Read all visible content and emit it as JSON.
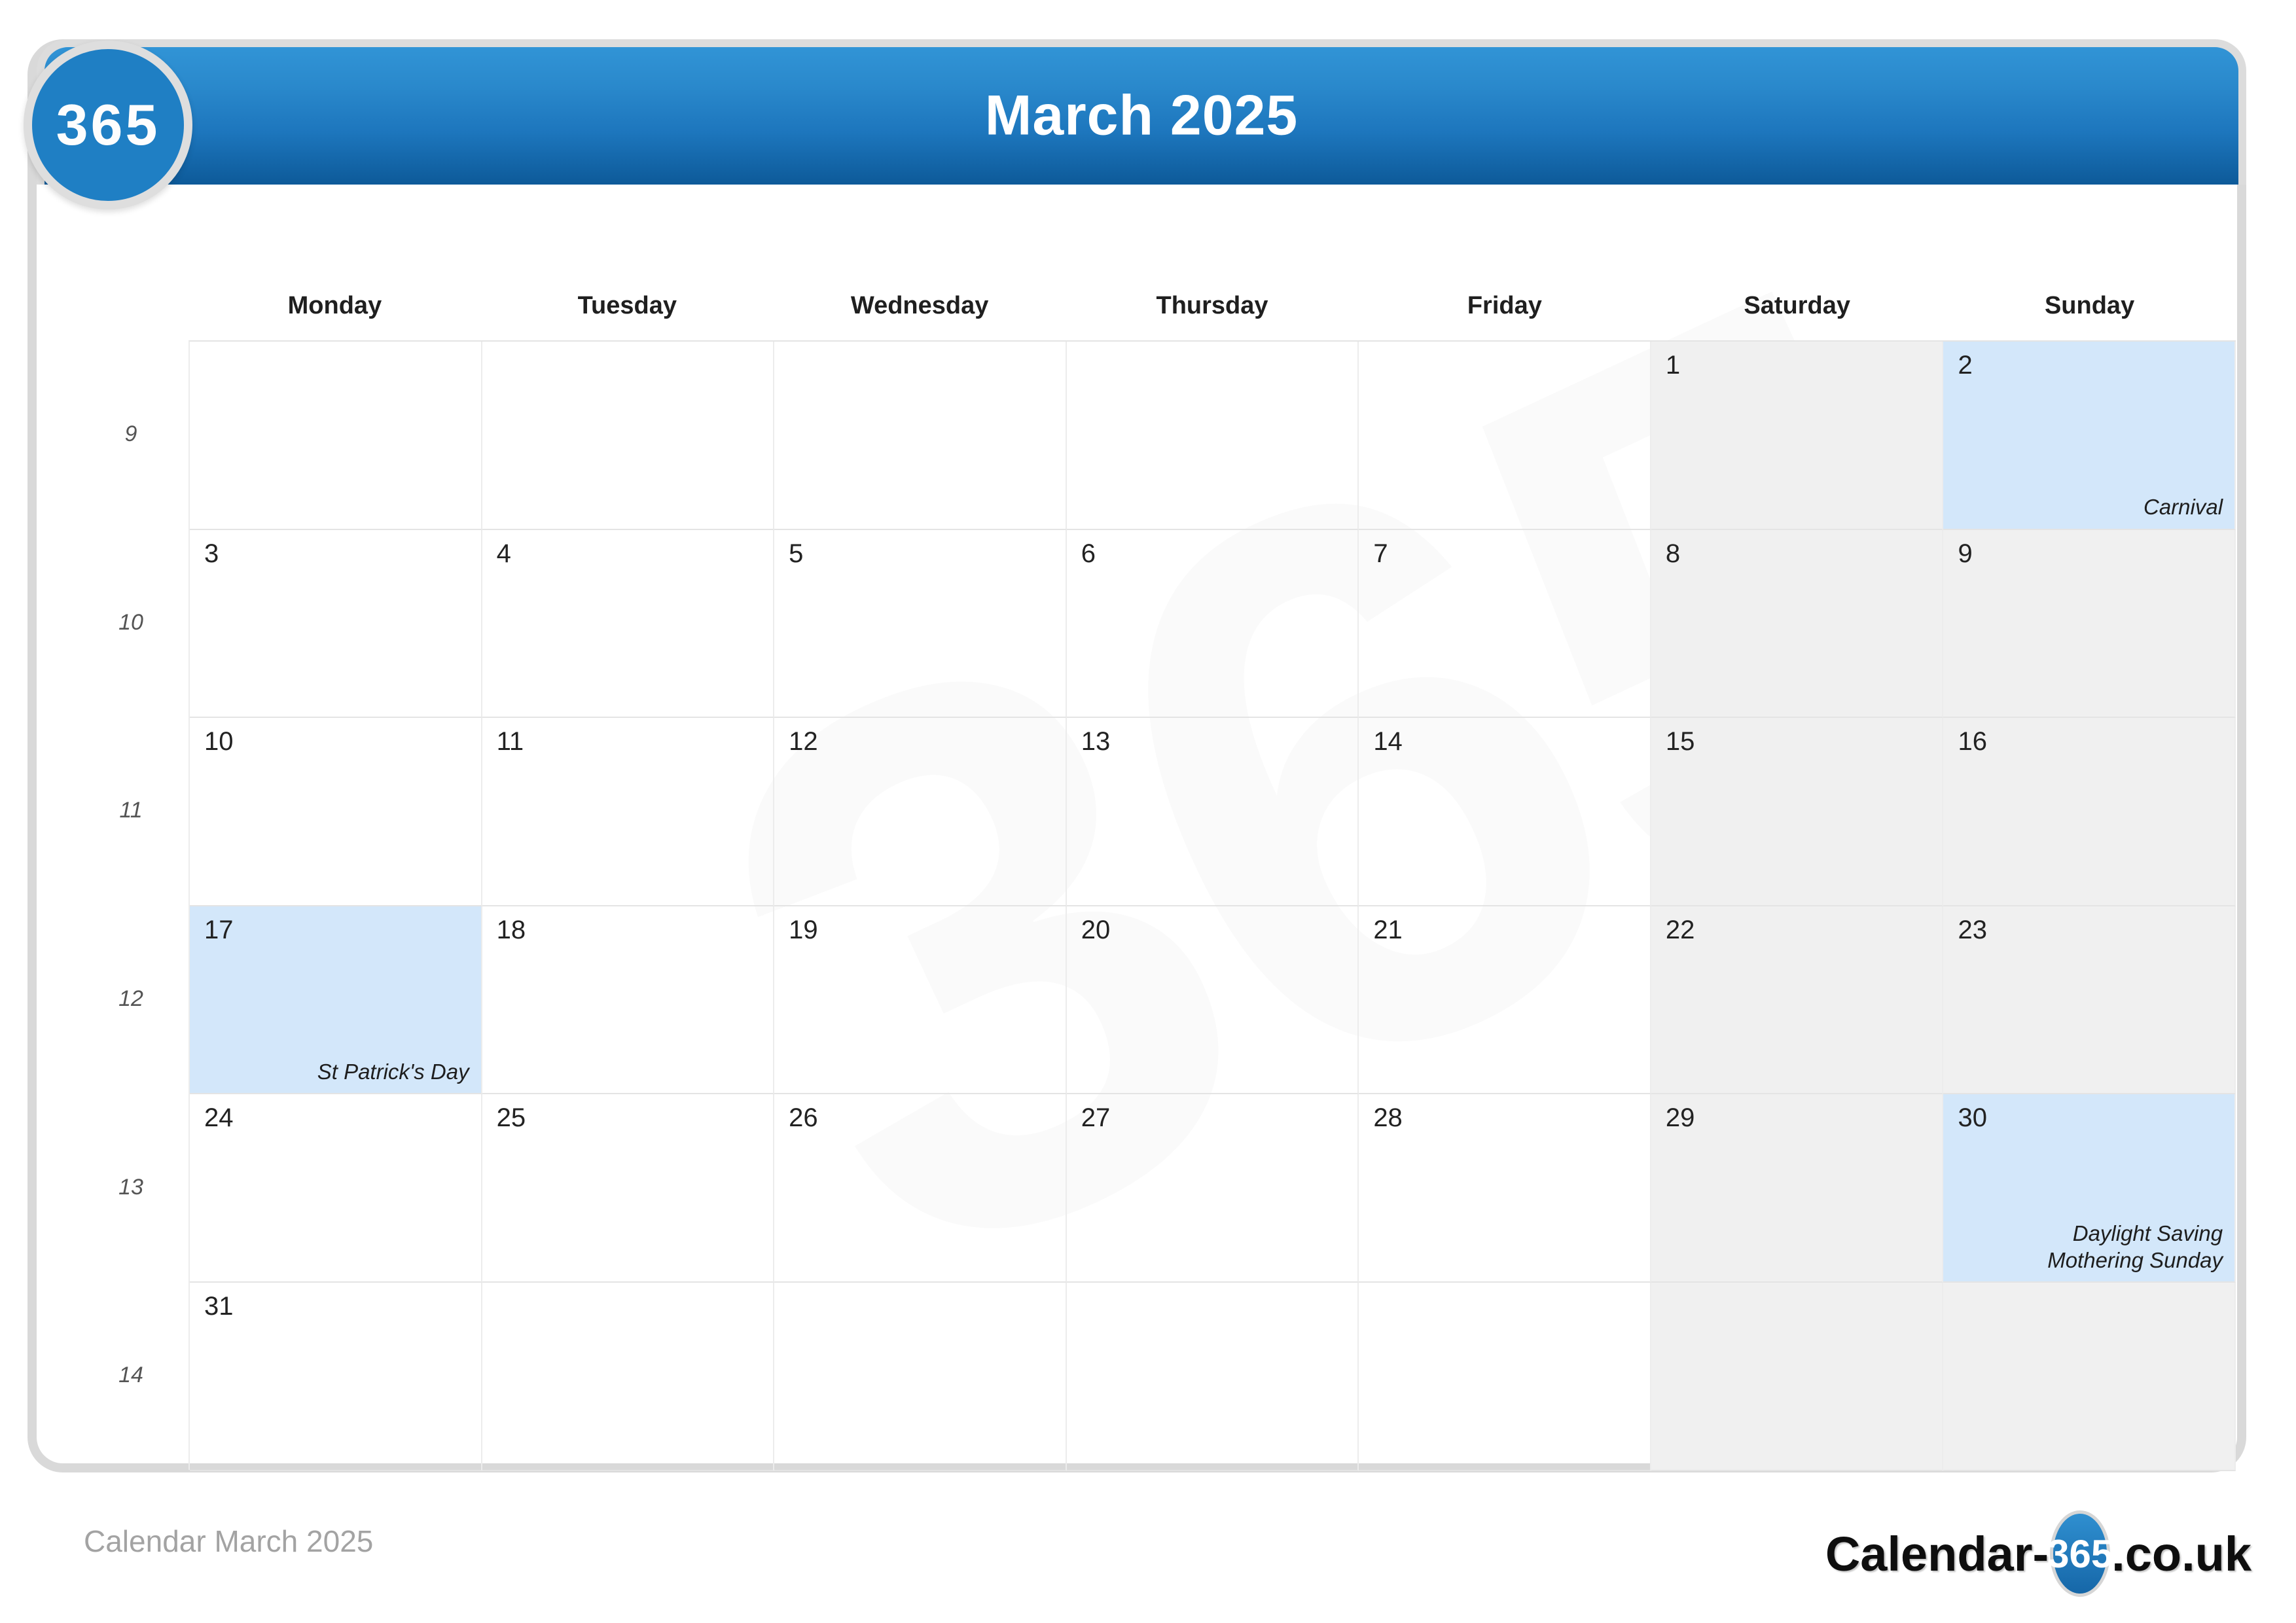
{
  "brand": {
    "badge_text": "365",
    "footer_logo_prefix": "Calendar-",
    "footer_logo_badge": "365",
    "footer_logo_suffix": ".co.uk"
  },
  "header": {
    "title": "March 2025"
  },
  "footer": {
    "caption": "Calendar March 2025"
  },
  "watermark": {
    "text": "365"
  },
  "calendar": {
    "weekday_headers": [
      "Monday",
      "Tuesday",
      "Wednesday",
      "Thursday",
      "Friday",
      "Saturday",
      "Sunday"
    ],
    "week_numbers": [
      "9",
      "10",
      "11",
      "12",
      "13",
      "14"
    ],
    "weeks": [
      {
        "week_number": "9",
        "days": [
          {
            "num": "",
            "events": [],
            "weekend": false,
            "highlight": false,
            "empty": true
          },
          {
            "num": "",
            "events": [],
            "weekend": false,
            "highlight": false,
            "empty": true
          },
          {
            "num": "",
            "events": [],
            "weekend": false,
            "highlight": false,
            "empty": true
          },
          {
            "num": "",
            "events": [],
            "weekend": false,
            "highlight": false,
            "empty": true
          },
          {
            "num": "",
            "events": [],
            "weekend": false,
            "highlight": false,
            "empty": true
          },
          {
            "num": "1",
            "events": [],
            "weekend": true,
            "highlight": false,
            "empty": false
          },
          {
            "num": "2",
            "events": [
              "Carnival"
            ],
            "weekend": true,
            "highlight": true,
            "empty": false
          }
        ]
      },
      {
        "week_number": "10",
        "days": [
          {
            "num": "3",
            "events": [],
            "weekend": false,
            "highlight": false,
            "empty": false
          },
          {
            "num": "4",
            "events": [],
            "weekend": false,
            "highlight": false,
            "empty": false
          },
          {
            "num": "5",
            "events": [],
            "weekend": false,
            "highlight": false,
            "empty": false
          },
          {
            "num": "6",
            "events": [],
            "weekend": false,
            "highlight": false,
            "empty": false
          },
          {
            "num": "7",
            "events": [],
            "weekend": false,
            "highlight": false,
            "empty": false
          },
          {
            "num": "8",
            "events": [],
            "weekend": true,
            "highlight": false,
            "empty": false
          },
          {
            "num": "9",
            "events": [],
            "weekend": true,
            "highlight": false,
            "empty": false
          }
        ]
      },
      {
        "week_number": "11",
        "days": [
          {
            "num": "10",
            "events": [],
            "weekend": false,
            "highlight": false,
            "empty": false
          },
          {
            "num": "11",
            "events": [],
            "weekend": false,
            "highlight": false,
            "empty": false
          },
          {
            "num": "12",
            "events": [],
            "weekend": false,
            "highlight": false,
            "empty": false
          },
          {
            "num": "13",
            "events": [],
            "weekend": false,
            "highlight": false,
            "empty": false
          },
          {
            "num": "14",
            "events": [],
            "weekend": false,
            "highlight": false,
            "empty": false
          },
          {
            "num": "15",
            "events": [],
            "weekend": true,
            "highlight": false,
            "empty": false
          },
          {
            "num": "16",
            "events": [],
            "weekend": true,
            "highlight": false,
            "empty": false
          }
        ]
      },
      {
        "week_number": "12",
        "days": [
          {
            "num": "17",
            "events": [
              "St Patrick's Day"
            ],
            "weekend": false,
            "highlight": true,
            "empty": false
          },
          {
            "num": "18",
            "events": [],
            "weekend": false,
            "highlight": false,
            "empty": false
          },
          {
            "num": "19",
            "events": [],
            "weekend": false,
            "highlight": false,
            "empty": false
          },
          {
            "num": "20",
            "events": [],
            "weekend": false,
            "highlight": false,
            "empty": false
          },
          {
            "num": "21",
            "events": [],
            "weekend": false,
            "highlight": false,
            "empty": false
          },
          {
            "num": "22",
            "events": [],
            "weekend": true,
            "highlight": false,
            "empty": false
          },
          {
            "num": "23",
            "events": [],
            "weekend": true,
            "highlight": false,
            "empty": false
          }
        ]
      },
      {
        "week_number": "13",
        "days": [
          {
            "num": "24",
            "events": [],
            "weekend": false,
            "highlight": false,
            "empty": false
          },
          {
            "num": "25",
            "events": [],
            "weekend": false,
            "highlight": false,
            "empty": false
          },
          {
            "num": "26",
            "events": [],
            "weekend": false,
            "highlight": false,
            "empty": false
          },
          {
            "num": "27",
            "events": [],
            "weekend": false,
            "highlight": false,
            "empty": false
          },
          {
            "num": "28",
            "events": [],
            "weekend": false,
            "highlight": false,
            "empty": false
          },
          {
            "num": "29",
            "events": [],
            "weekend": true,
            "highlight": false,
            "empty": false
          },
          {
            "num": "30",
            "events": [
              "Daylight Saving",
              "Mothering Sunday"
            ],
            "weekend": true,
            "highlight": true,
            "empty": false
          }
        ]
      },
      {
        "week_number": "14",
        "days": [
          {
            "num": "31",
            "events": [],
            "weekend": false,
            "highlight": false,
            "empty": false
          },
          {
            "num": "",
            "events": [],
            "weekend": false,
            "highlight": false,
            "empty": true
          },
          {
            "num": "",
            "events": [],
            "weekend": false,
            "highlight": false,
            "empty": true
          },
          {
            "num": "",
            "events": [],
            "weekend": false,
            "highlight": false,
            "empty": true
          },
          {
            "num": "",
            "events": [],
            "weekend": false,
            "highlight": false,
            "empty": true
          },
          {
            "num": "",
            "events": [],
            "weekend": true,
            "highlight": false,
            "empty": true
          },
          {
            "num": "",
            "events": [],
            "weekend": true,
            "highlight": false,
            "empty": true
          }
        ]
      }
    ]
  },
  "colors": {
    "header_blue_top": "#3194d6",
    "header_blue_bottom": "#0d5a99",
    "highlight_blue": "#d3e7fa",
    "weekend_gray": "#f0f0f0",
    "card_border": "#d9d9d9",
    "footer_text": "#a3a3a3"
  }
}
